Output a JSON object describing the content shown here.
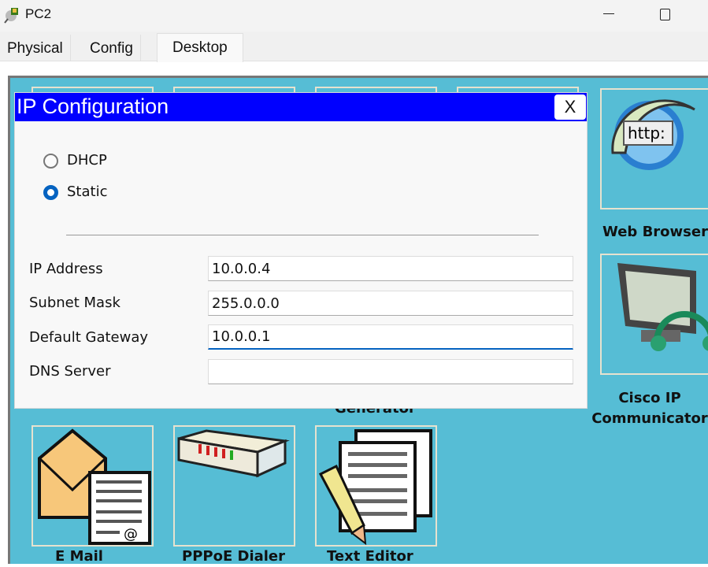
{
  "window": {
    "title": "PC2"
  },
  "tabs": [
    {
      "label": "Physical"
    },
    {
      "label": "Config"
    },
    {
      "label": "Desktop",
      "active": true
    }
  ],
  "desktop": {
    "apps": [
      {
        "label": "Web Browser",
        "icon": "web-browser-icon"
      },
      {
        "label": "Cisco IP",
        "label2": "Communicator",
        "icon": "ip-phone-icon"
      },
      {
        "label": "Generator"
      },
      {
        "label": "E Mail",
        "icon": "email-icon"
      },
      {
        "label": "PPPoE Dialer",
        "icon": "pppoe-dialer-icon"
      },
      {
        "label": "Text Editor",
        "icon": "text-editor-icon"
      }
    ],
    "browser_icon_text": "http:",
    "background_color": "#56bdd5"
  },
  "dialog": {
    "title": "IP Configuration",
    "close_label": "X",
    "header_color": "#0000ff",
    "modes": [
      {
        "label": "DHCP",
        "selected": false
      },
      {
        "label": "Static",
        "selected": true
      }
    ],
    "fields": [
      {
        "label": "IP Address",
        "value": "10.0.0.4"
      },
      {
        "label": "Subnet Mask",
        "value": "255.0.0.0"
      },
      {
        "label": "Default Gateway",
        "value": "10.0.0.1",
        "focused": true
      },
      {
        "label": "DNS Server",
        "value": ""
      }
    ]
  }
}
